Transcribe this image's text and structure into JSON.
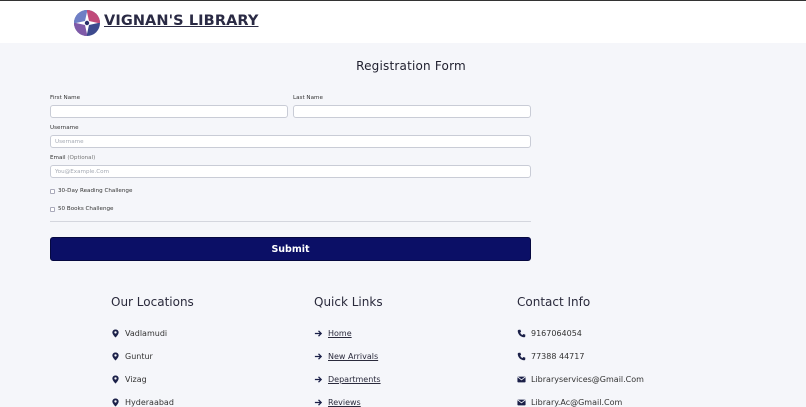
{
  "header": {
    "brand": "VIGNAN'S LIBRARY"
  },
  "form": {
    "title": "Registration Form",
    "first_name_label": "First Name",
    "last_name_label": "Last Name",
    "username_label": "Username",
    "username_placeholder": "Username",
    "email_label": "Email",
    "email_optional": "(Optional)",
    "email_placeholder": "You@Example.Com",
    "challenge_1": "30-Day Reading Challenge",
    "challenge_2": "50 Books Challenge",
    "submit_label": "Submit"
  },
  "footer": {
    "locations": {
      "title": "Our Locations",
      "items": [
        "Vadlamudi",
        "Guntur",
        "Vizag",
        "Hyderaabad"
      ]
    },
    "quick_links": {
      "title": "Quick Links",
      "items": [
        " Home",
        " New Arrivals",
        " Departments",
        " Reviews"
      ]
    },
    "contact": {
      "title": "Contact Info",
      "items": [
        "9167064054",
        "77388 44717",
        "Libraryservices@Gmail.Com",
        "Library.Ac@Gmail.Com"
      ]
    }
  },
  "colors": {
    "primary": "#0b0f66",
    "background": "#f5f6fa",
    "icon": "#1b2048"
  }
}
